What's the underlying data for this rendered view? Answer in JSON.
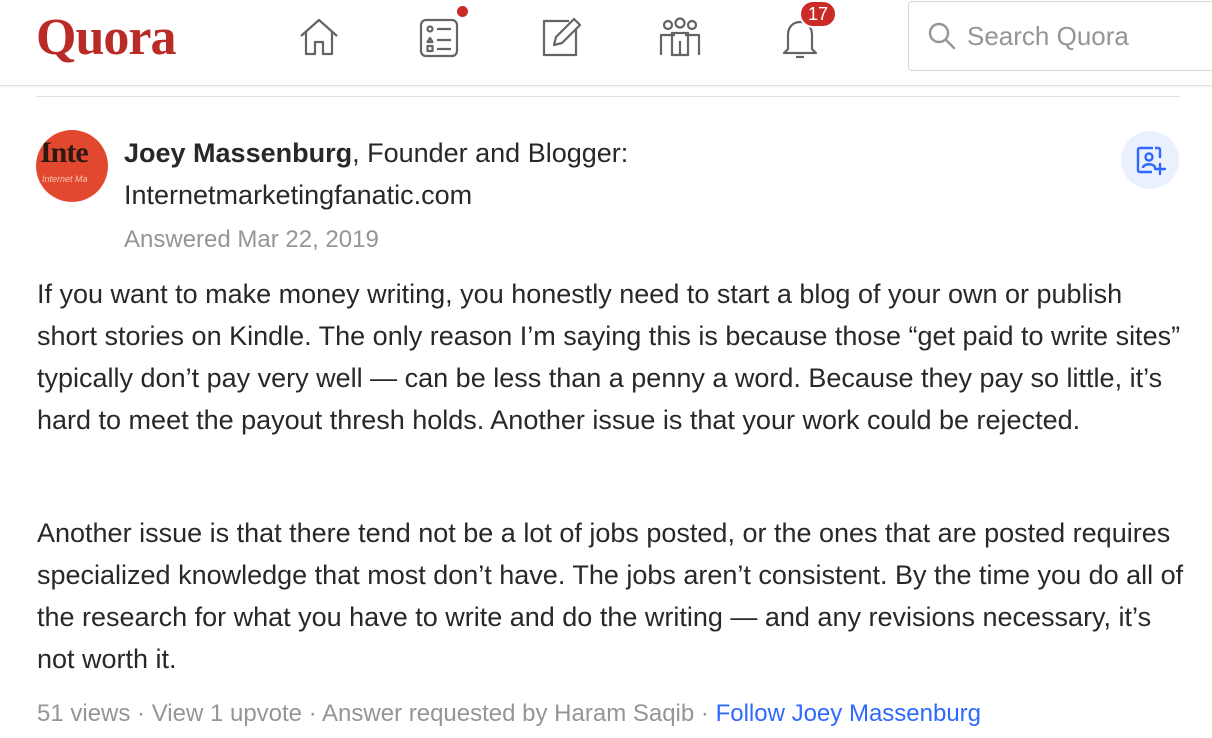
{
  "header": {
    "logo": "Quora",
    "nav": [
      {
        "name": "home-icon"
      },
      {
        "name": "answer-list-icon",
        "has_dot": true
      },
      {
        "name": "write-icon"
      },
      {
        "name": "spaces-icon"
      },
      {
        "name": "notifications-bell-icon",
        "badge": "17"
      }
    ],
    "search_placeholder": "Search Quora"
  },
  "answer": {
    "avatar": {
      "big": "Inte",
      "small": "Internet Ma"
    },
    "author_name": "Joey Massenburg",
    "credential_prefix": ", Founder and Blogger:",
    "credential_line2": "Internetmarketingfanatic.com",
    "answered": "Answered Mar 22, 2019",
    "paragraphs": [
      "If you want to make money writing, you honestly need to start a blog of your own or publish short stories on Kindle. The only reason I’m saying this is because those “get paid to write sites” typically don’t pay very well — can be less than a penny a word. Because they pay so little, it’s hard to meet the payout thresh holds. Another issue is that your work could be rejected.",
      "Another issue is that there tend not be a lot of jobs posted, or the ones that are posted requires specialized knowledge that most don’t have. The jobs aren’t consistent. By the time you do all of the research for what you have to write and do the writing — and any revisions necessary, it’s not worth it."
    ],
    "footer": {
      "views": "51 views",
      "sep": " · ",
      "upvote": "View 1 upvote",
      "requested": "Answer requested by Haram Saqib",
      "follow": "Follow Joey Massenburg"
    }
  },
  "colors": {
    "brand": "#b92b27",
    "link": "#2e69ff",
    "muted": "#939598",
    "text": "#282829"
  }
}
